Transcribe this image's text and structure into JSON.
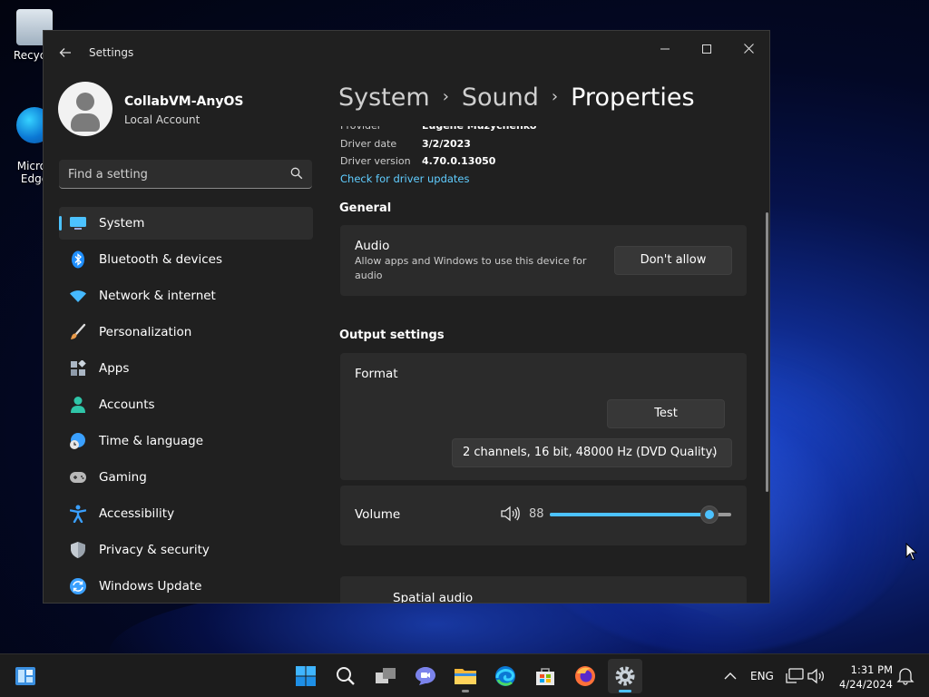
{
  "desktop": {
    "icons": [
      {
        "label": "Recycle",
        "icon": "recycle-bin-icon"
      },
      {
        "label": "Micros\nEdge",
        "icon": "edge-icon"
      }
    ]
  },
  "window": {
    "title": "Settings",
    "controls": {
      "minimize": "minimize-icon",
      "maximize": "maximize-icon",
      "close": "close-icon"
    }
  },
  "sidebar": {
    "user": {
      "name": "CollabVM-AnyOS",
      "account_type": "Local Account"
    },
    "search": {
      "placeholder": "Find a setting"
    },
    "items": [
      {
        "label": "System",
        "icon": "system-icon",
        "color": "#4cc2ff",
        "active": true
      },
      {
        "label": "Bluetooth & devices",
        "icon": "bluetooth-icon",
        "color": "#1f8fff"
      },
      {
        "label": "Network & internet",
        "icon": "wifi-icon",
        "color": "#45b9ff"
      },
      {
        "label": "Personalization",
        "icon": "brush-icon",
        "color": "#e89a4a"
      },
      {
        "label": "Apps",
        "icon": "apps-icon",
        "color": "#aab6c4"
      },
      {
        "label": "Accounts",
        "icon": "person-icon",
        "color": "#2fc5a8"
      },
      {
        "label": "Time & language",
        "icon": "globe-clock-icon",
        "color": "#3aa0ff"
      },
      {
        "label": "Gaming",
        "icon": "gamepad-icon",
        "color": "#b8b8b8"
      },
      {
        "label": "Accessibility",
        "icon": "accessibility-icon",
        "color": "#3aa0ff"
      },
      {
        "label": "Privacy & security",
        "icon": "shield-icon",
        "color": "#9aa3ad"
      },
      {
        "label": "Windows Update",
        "icon": "update-icon",
        "color": "#3aa0ff"
      }
    ]
  },
  "main": {
    "breadcrumb": [
      "System",
      "Sound",
      "Properties"
    ],
    "driver": {
      "provider_label": "Provider",
      "provider_value": "Eugene Muzychenko",
      "date_label": "Driver date",
      "date_value": "3/2/2023",
      "version_label": "Driver version",
      "version_value": "4.70.0.13050",
      "update_link": "Check for driver updates"
    },
    "general": {
      "heading": "General",
      "audio_title": "Audio",
      "audio_desc": "Allow apps and Windows to use this device for audio",
      "audio_button": "Don't allow"
    },
    "output": {
      "heading": "Output settings",
      "format_title": "Format",
      "test_button": "Test",
      "format_value": "2 channels, 16 bit, 48000 Hz (DVD Quality)",
      "volume_title": "Volume",
      "volume_value": "88",
      "volume_level": 0.88,
      "spatial_title": "Spatial audio"
    }
  },
  "taskbar": {
    "apps": [
      {
        "name": "start",
        "icon": "windows-logo-icon"
      },
      {
        "name": "search",
        "icon": "search-icon"
      },
      {
        "name": "task-view",
        "icon": "task-view-icon"
      },
      {
        "name": "chat",
        "icon": "teams-chat-icon"
      },
      {
        "name": "file-explorer",
        "icon": "folder-icon"
      },
      {
        "name": "edge",
        "icon": "edge-icon"
      },
      {
        "name": "store",
        "icon": "store-icon"
      },
      {
        "name": "firefox",
        "icon": "firefox-icon"
      },
      {
        "name": "settings",
        "icon": "gear-icon"
      }
    ],
    "language": "ENG",
    "time": "1:31 PM",
    "date": "4/24/2024"
  },
  "colors": {
    "accent": "#4cc2ff",
    "link": "#60cdff",
    "window_bg": "#202020",
    "card_bg": "#2b2b2b"
  }
}
